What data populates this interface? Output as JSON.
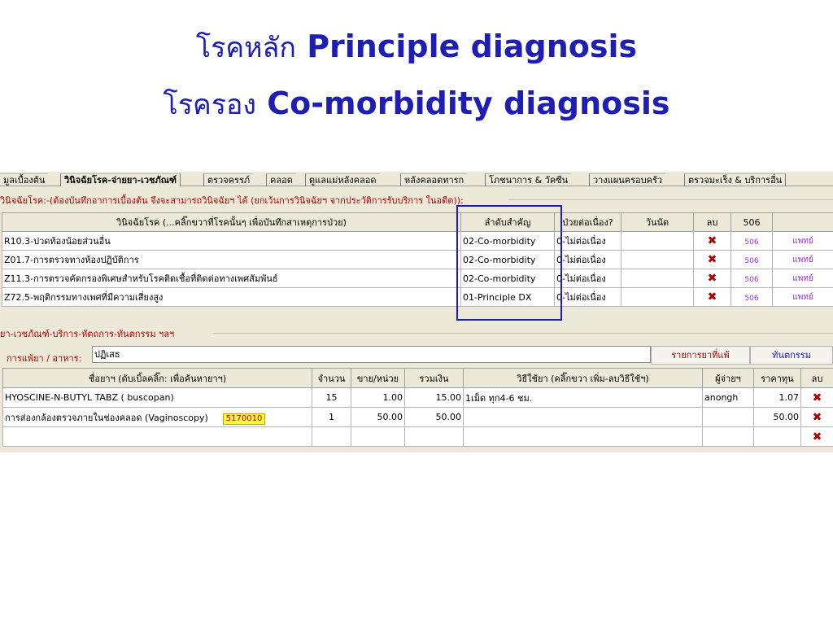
{
  "slide": {
    "title_line1_thai": "โรคหลัก",
    "title_line1_en": "Principle diagnosis",
    "title_line2_thai": "โรครอง",
    "title_line2_en": "Co-morbidity diagnosis"
  },
  "tabs": [
    "มูลเบื้องต้น",
    "วินิจฉัยโรค-จ่ายยา-เวชภัณฑ์",
    "ตรวจครรภ์",
    "คลอด",
    "ดูแลแม่หลังคลอด",
    "หลังคลอดทารก",
    "โภชนาการ & วัคซีน",
    "วางแผนครอบครัว",
    "ตรวจมะเร็ง & บริการอื่น"
  ],
  "diagnosis_section": {
    "label": "วินิจฉัยโรค:-(ต้องบันทึกอาการเบื้องต้น จึงจะสามารถวินิจฉัยฯ ได้ (ยกเว้นการวินิจฉัยฯ จากประวัติการรับบริการ ในอดีต)):",
    "headers": [
      "วินิจฉัยโรค (...คลิ๊กขวาที่โรคนั้นๆ เพื่อบันทึกสาเหตุการป่วย)",
      "ลำดับสำคัญ",
      "ป่วยต่อเนื่อง?",
      "วันนัด",
      "ลบ",
      "506",
      ""
    ],
    "rows": [
      {
        "dx": "R10.3-ปวดท้องน้อยส่วนอื่น",
        "rank": "02-Co-morbidity",
        "cont": "0-ไม่ต่อเนื่อง",
        "appt": "",
        "del": "✖",
        "b506": "506",
        "doc": "แพทย์"
      },
      {
        "dx": "Z01.7-การตรวจทางห้องปฏิบัติการ",
        "rank": "02-Co-morbidity",
        "cont": "0-ไม่ต่อเนื่อง",
        "appt": "",
        "del": "✖",
        "b506": "506",
        "doc": "แพทย์"
      },
      {
        "dx": "Z11.3-การตรวจคัดกรองพิเศษสำหรับโรคติดเชื้อที่ติดต่อทางเพศสัมพันธ์",
        "rank": "02-Co-morbidity",
        "cont": "0-ไม่ต่อเนื่อง",
        "appt": "",
        "del": "✖",
        "b506": "506",
        "doc": "แพทย์"
      },
      {
        "dx": "Z72.5-พฤติกรรมทางเพศที่มีความเสี่ยงสูง",
        "rank": "01-Principle DX",
        "cont": "0-ไม่ต่อเนื่อง",
        "appt": "",
        "del": "✖",
        "b506": "506",
        "doc": "แพทย์"
      }
    ]
  },
  "drug_section": {
    "label": "ยา-เวชภัณฑ์-บริการ-หัตถการ-ทันตกรรม ฯลฯ",
    "allergy_label": "การแพ้ยา / อาหาร:",
    "allergy_value": "ปฏิเสธ",
    "allergy_list_button": "รายการยาที่แพ้",
    "dental_button": "ทันตกรรม",
    "headers": [
      "ชื่อยาฯ (ดับเบิ้ลคลิ๊ก: เพื่อค้นหายาฯ)",
      "จำนวน",
      "ขาย/หน่วย",
      "รวมเงิน",
      "วิธีใช้ยา (คลิ๊กขวา เพิ่ม-ลบวิธีใช้ฯ)",
      "ผู้จ่ายฯ",
      "ราคาทุน",
      "ลบ"
    ],
    "rows": [
      {
        "name": "HYOSCINE-N-BUTYL TABZ ( buscopan)",
        "code": "",
        "qty": "15",
        "unit": "1.00",
        "total": "15.00",
        "usage": "1เม็ด ทุก4-6 ชม.",
        "payer": "anongh",
        "cost": "1.07",
        "del": "✖"
      },
      {
        "name": "การส่องกล้องตรวจภายในช่องคลอด (Vaginoscopy)",
        "code": "5170010",
        "qty": "1",
        "unit": "50.00",
        "total": "50.00",
        "usage": "",
        "payer": "",
        "cost": "50.00",
        "del": "✖"
      },
      {
        "name": "",
        "code": "",
        "qty": "",
        "unit": "",
        "total": "",
        "usage": "",
        "payer": "",
        "cost": "",
        "del": "✖"
      }
    ]
  }
}
